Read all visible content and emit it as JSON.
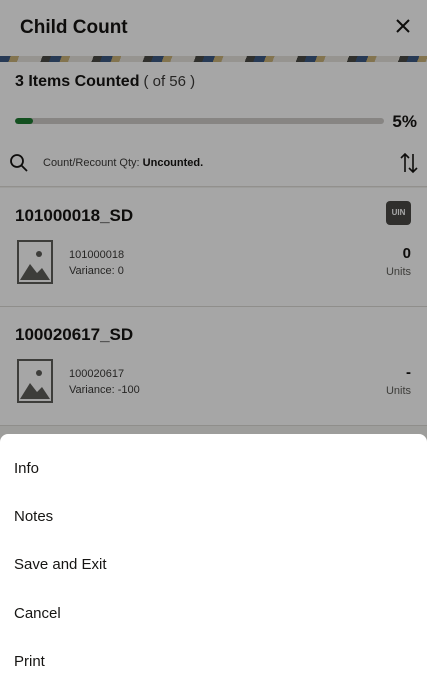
{
  "header": {
    "title": "Child Count",
    "close_icon": "close-icon"
  },
  "progress": {
    "counted_label": "3 Items Counted",
    "total_label": "( of 56 )",
    "percent_label": "5%",
    "percent_value": 0.05,
    "fill_color": "#1e7b32"
  },
  "search": {
    "icon": "search-icon",
    "filter_prefix": "Count/Recount Qty:",
    "filter_value": "Uncounted.",
    "sort_icon": "sort-icon"
  },
  "items": [
    {
      "name": "101000018_SD",
      "badge": "UIN",
      "sku": "101000018",
      "variance": "Variance: 0",
      "qty": "0",
      "units": "Units"
    },
    {
      "name": "100020617_SD",
      "sku": "100020617",
      "variance": "Variance: -100",
      "qty": "-",
      "units": "Units"
    }
  ],
  "menu": {
    "items": [
      "Info",
      "Notes",
      "Save and Exit",
      "Cancel",
      "Print"
    ]
  }
}
